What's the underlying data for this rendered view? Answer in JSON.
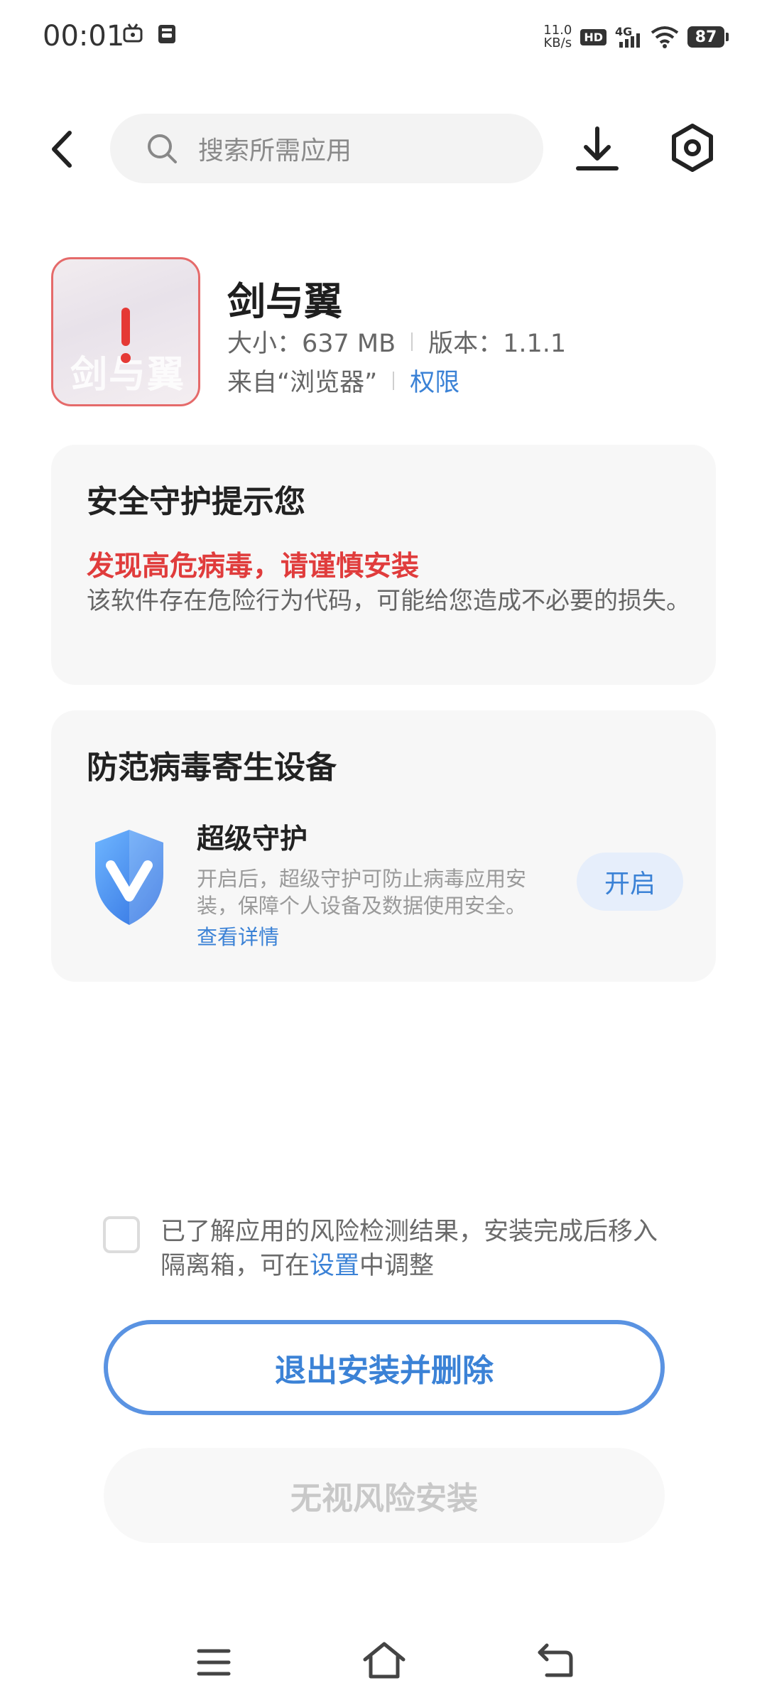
{
  "status_bar": {
    "time": "00:01",
    "speed_value": "11.0",
    "speed_unit": "KB/s",
    "hd": "HD",
    "network": "4G",
    "battery": "87"
  },
  "header": {
    "search_placeholder": "搜索所需应用",
    "icons": [
      "back-arrow-icon",
      "search-icon",
      "download-icon",
      "settings-icon"
    ]
  },
  "app": {
    "name": "剑与翼",
    "size_label": "大小：637 MB",
    "version_label": "版本：1.1.1",
    "source_label": "来自“浏览器”",
    "permission_link": "权限",
    "icon_text": "剑与翼"
  },
  "security_card": {
    "title": "安全守护提示您",
    "headline": "发现高危病毒，请谨慎安装",
    "body": "该软件存在危险行为代码，可能给您造成不必要的损失。"
  },
  "protection_card": {
    "title": "防范病毒寄生设备",
    "feature_title": "超级守护",
    "feature_desc": "开启后，超级守护可防止病毒应用安装，保障个人设备及数据使用安全。",
    "detail_link": "查看详情",
    "enable_button": "开启"
  },
  "consent": {
    "text_before": "已了解应用的风险检测结果，安装完成后移入隔离箱，可在",
    "settings_link": "设置",
    "text_after": "中调整",
    "checked": false
  },
  "actions": {
    "exit_delete": "退出安装并删除",
    "ignore_install": "无视风险安装"
  },
  "colors": {
    "accent": "#3b82d6",
    "danger": "#e03c3c",
    "card_bg": "#f7f7f7"
  }
}
